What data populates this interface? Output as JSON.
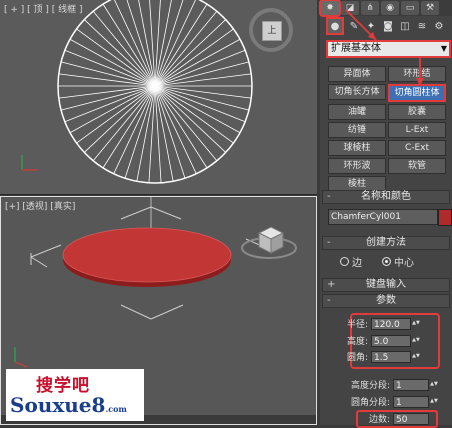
{
  "viewports": {
    "top_label": "[ + ] [ 顶 ] [ 线框 ]",
    "persp_label": "[+] [透视] [真实]",
    "viewcube_top_label": "上"
  },
  "command_panel": {
    "tabs": [
      "create",
      "modify",
      "hierarchy",
      "motion",
      "display",
      "utilities"
    ],
    "subtabs": [
      "geometry",
      "shapes",
      "lights",
      "cameras",
      "helpers",
      "space-warps",
      "systems"
    ],
    "category_dropdown": "扩展基本体",
    "object_types": [
      {
        "label": "异面体"
      },
      {
        "label": "环形结"
      },
      {
        "label": "切角长方体"
      },
      {
        "label": "切角圆柱体",
        "selected": true
      },
      {
        "label": "油罐"
      },
      {
        "label": "胶囊"
      },
      {
        "label": "纺锤"
      },
      {
        "label": "L-Ext"
      },
      {
        "label": "球棱柱"
      },
      {
        "label": "C-Ext"
      },
      {
        "label": "环形波"
      },
      {
        "label": "软管"
      },
      {
        "label": "棱柱"
      }
    ],
    "name_color_header": "名称和颜色",
    "object_name": "ChamferCyl001",
    "object_color": "#b12a2a",
    "creation_method_header": "创建方法",
    "creation_options": [
      {
        "label": "边",
        "checked": false
      },
      {
        "label": "中心",
        "checked": true
      }
    ],
    "keyboard_entry_header": "键盘输入",
    "parameters_header": "参数",
    "params": {
      "radius_label": "半径:",
      "radius": "120.0",
      "height_label": "高度:",
      "height": "5.0",
      "fillet_label": "圆角:",
      "fillet": "1.5",
      "height_segs_label": "高度分段:",
      "height_segs": "1",
      "fillet_segs_label": "圆角分段:",
      "fillet_segs": "1",
      "sides_label": "边数:",
      "sides": "50"
    }
  },
  "watermark": {
    "top": "搜学吧",
    "bottom": "Souxue8",
    "suffix": ".com"
  },
  "accent_color": "#e23b3b"
}
